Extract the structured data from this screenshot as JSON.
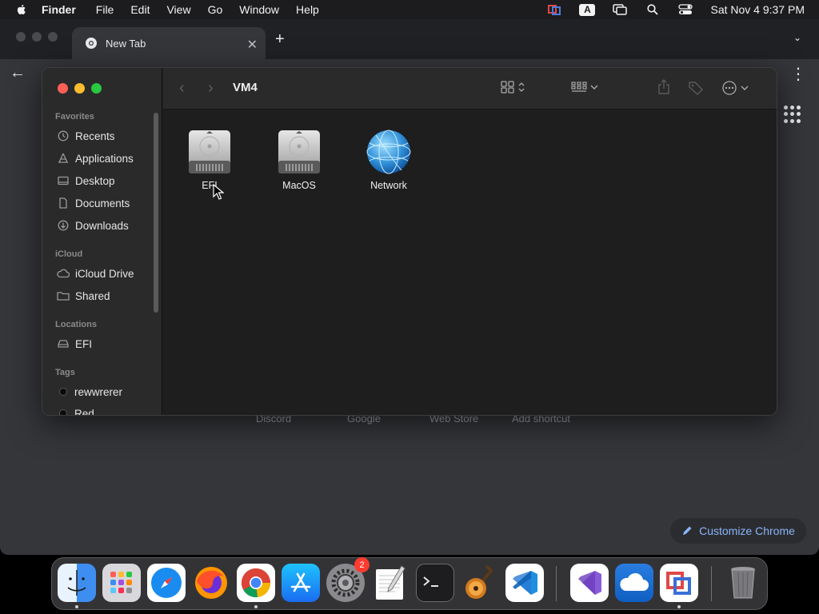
{
  "menubar": {
    "app_name": "Finder",
    "menus": [
      "File",
      "Edit",
      "View",
      "Go",
      "Window",
      "Help"
    ],
    "input_source": "A",
    "clock": "Sat Nov 4  9:37 PM"
  },
  "chrome": {
    "tab_title": "New Tab",
    "new_tab_symbol": "+",
    "shortcuts": [
      "Discord",
      "Google",
      "Web Store",
      "Add shortcut"
    ],
    "customize_label": "Customize Chrome"
  },
  "finder": {
    "title": "VM4",
    "sidebar": {
      "favorites_header": "Favorites",
      "favorites": [
        "Recents",
        "Applications",
        "Desktop",
        "Documents",
        "Downloads"
      ],
      "icloud_header": "iCloud",
      "icloud": [
        "iCloud Drive",
        "Shared"
      ],
      "locations_header": "Locations",
      "locations": [
        "EFI"
      ],
      "tags_header": "Tags",
      "tags": [
        "rewwrerer",
        "Red"
      ]
    },
    "items": [
      {
        "label": "EFI",
        "icon": "hard-drive-icon"
      },
      {
        "label": "MacOS",
        "icon": "hard-drive-icon"
      },
      {
        "label": "Network",
        "icon": "network-globe-icon"
      }
    ]
  },
  "dock": {
    "apps": [
      "Finder",
      "Launchpad",
      "Safari",
      "Firefox",
      "Google Chrome",
      "App Store",
      "System Settings",
      "TextEdit",
      "Terminal",
      "GarageBand",
      "Visual Studio Code",
      "Visual Studio",
      "OneDrive",
      "Parallels",
      "Trash"
    ],
    "settings_badge": "2"
  },
  "colors": {
    "menubar_bg": "#1c1c1e",
    "finder_sidebar_bg": "#2b2a2b",
    "finder_content_bg": "#1e1e1e",
    "chrome_bg": "#35363a",
    "accent_blue": "#8ab4f8"
  }
}
